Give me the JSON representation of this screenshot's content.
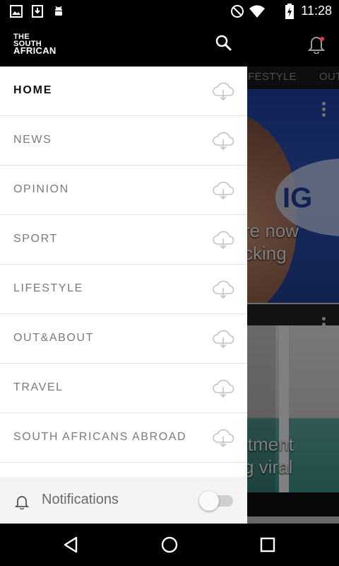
{
  "status_bar": {
    "time": "11:28",
    "left_icons": [
      "image-icon",
      "download-icon",
      "android-icon"
    ],
    "right_icons": [
      "do-not-disturb-icon",
      "wifi-icon",
      "battery-charging-icon"
    ]
  },
  "header": {
    "logo_lines": [
      "THE",
      "SOUTH",
      "AFRICAN"
    ],
    "search_icon": "search-icon",
    "notification_icon": "bell-icon"
  },
  "tabs": [
    "LIFESTYLE",
    "OUT"
  ],
  "articles": [
    {
      "title_lines": [
        "re now",
        "cking"
      ]
    },
    {
      "title_lines": [
        "itment",
        "g viral"
      ]
    }
  ],
  "drawer": {
    "menu": [
      {
        "label": "HOME",
        "active": true,
        "icon": "cloud-download-icon"
      },
      {
        "label": "NEWS",
        "active": false,
        "icon": "cloud-download-icon"
      },
      {
        "label": "OPINION",
        "active": false,
        "icon": "cloud-download-icon"
      },
      {
        "label": "SPORT",
        "active": false,
        "icon": "cloud-download-icon"
      },
      {
        "label": "LIFESTYLE",
        "active": false,
        "icon": "cloud-download-icon"
      },
      {
        "label": "OUT&ABOUT",
        "active": false,
        "icon": "cloud-download-icon"
      },
      {
        "label": "TRAVEL",
        "active": false,
        "icon": "cloud-download-icon"
      },
      {
        "label": "SOUTH AFRICANS ABROAD",
        "active": false,
        "icon": "cloud-download-icon"
      }
    ],
    "notifications": {
      "label": "Notifications",
      "enabled": false
    }
  },
  "nav_bar": {
    "buttons": [
      "back-icon",
      "home-icon",
      "recents-icon"
    ]
  },
  "colors": {
    "header_bg": "#000000",
    "drawer_bg": "#ffffff",
    "accent_dot": "#e53935",
    "menu_text": "#7a7a7a",
    "menu_active": "#111111"
  }
}
